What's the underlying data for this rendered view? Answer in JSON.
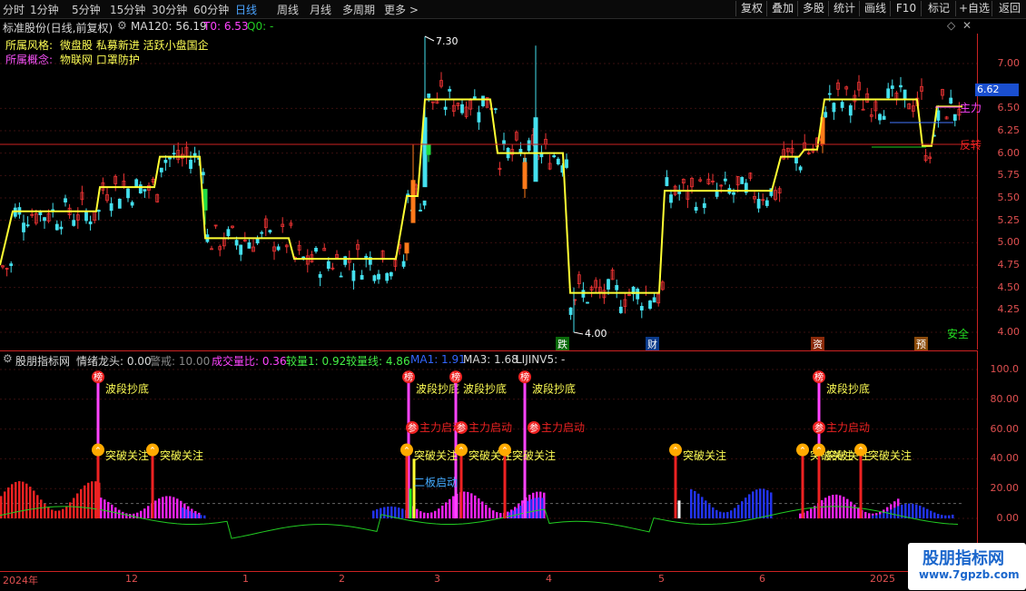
{
  "toolbar": {
    "periods": [
      "分时",
      "1分钟",
      "5分钟",
      "15分钟",
      "30分钟",
      "60分钟",
      "日线",
      "周线",
      "月线",
      "多周期",
      "更多 >"
    ],
    "active_period": "日线",
    "tools": [
      "复权",
      "叠加",
      "多股",
      "统计",
      "画线",
      "F10",
      "标记",
      "+自选",
      "返回"
    ]
  },
  "main_header": {
    "stock": "标准股份(日线,前复权)",
    "ma120": "MA120: 56.19",
    "t0": "T0: 6.53",
    "q0": "Q0: -"
  },
  "info": {
    "style_label": "所属风格:",
    "style_value": "微盘股 私募新进 活跃小盘国企",
    "concept_label": "所属概念:",
    "concept_value": "物联网 口罩防护"
  },
  "main_axis": [
    "7.00",
    "6.50",
    "6.25",
    "6.00",
    "5.75",
    "5.50",
    "5.25",
    "5.00",
    "4.75",
    "4.50",
    "4.25",
    "4.00"
  ],
  "price_tag": "6.62",
  "high_label": "7.30",
  "low_label": "4.00",
  "right_labels": {
    "main": "主力",
    "reverse": "反转",
    "safe": "安全"
  },
  "events": [
    "跌",
    "财",
    "资",
    "预"
  ],
  "indicator_header": {
    "name": "股朋指标网",
    "qxlt": "情绪龙头: 0.00",
    "jj": "警戒: 10.00",
    "cjlb": "成交量比: 0.36",
    "jl1": "较量1: 0.92",
    "jlx": "较量线: 4.86",
    "ma1": "MA1: 1.91",
    "ma3": "MA3: 1.68",
    "lijin": "LIJINV5: -"
  },
  "ind_axis": [
    "100.0",
    "80.00",
    "60.00",
    "40.00",
    "20.00",
    "0.00"
  ],
  "signals": {
    "bang": "榜",
    "can": "参",
    "bodi": "波段抄底",
    "zhuli": "主力启动",
    "tupo": "突破关注",
    "erban": "二板启动"
  },
  "dates": [
    "2024年",
    "12",
    "1",
    "2",
    "3",
    "4",
    "5",
    "6",
    "2025"
  ],
  "watermark": {
    "title": "股朋指标网",
    "url": "www.7gpzb.com"
  },
  "chart_data": {
    "type": "candlestick",
    "title": "标准股份(日线,前复权)",
    "ylim": [
      3.9,
      7.4
    ],
    "y_ticks": [
      4.0,
      4.25,
      4.5,
      4.75,
      5.0,
      5.25,
      5.5,
      5.75,
      6.0,
      6.25,
      6.5,
      7.0
    ],
    "high": 7.3,
    "low": 4.0,
    "current": 6.62,
    "x_labels": [
      "2024年",
      "12",
      "1",
      "2",
      "3",
      "4",
      "5",
      "6",
      "2025"
    ],
    "yellow_step_line": [
      [
        0,
        4.75
      ],
      [
        14,
        5.35
      ],
      [
        106,
        5.35
      ],
      [
        110,
        5.62
      ],
      [
        170,
        5.62
      ],
      [
        176,
        5.96
      ],
      [
        220,
        5.96
      ],
      [
        226,
        5.05
      ],
      [
        318,
        5.05
      ],
      [
        324,
        4.82
      ],
      [
        436,
        4.82
      ],
      [
        448,
        5.52
      ],
      [
        460,
        5.52
      ],
      [
        468,
        6.6
      ],
      [
        540,
        6.6
      ],
      [
        548,
        6.0
      ],
      [
        620,
        6.0
      ],
      [
        628,
        4.44
      ],
      [
        726,
        4.44
      ],
      [
        732,
        5.58
      ],
      [
        850,
        5.58
      ],
      [
        860,
        5.96
      ],
      [
        880,
        5.96
      ],
      [
        886,
        6.04
      ],
      [
        900,
        6.04
      ],
      [
        908,
        6.6
      ],
      [
        1010,
        6.6
      ],
      [
        1016,
        6.08
      ],
      [
        1026,
        6.08
      ],
      [
        1032,
        6.52
      ],
      [
        1060,
        6.52
      ]
    ],
    "indicator_ylim": [
      -15,
      110
    ],
    "indicator_ticks": [
      0,
      20,
      40,
      60,
      80,
      100
    ]
  }
}
